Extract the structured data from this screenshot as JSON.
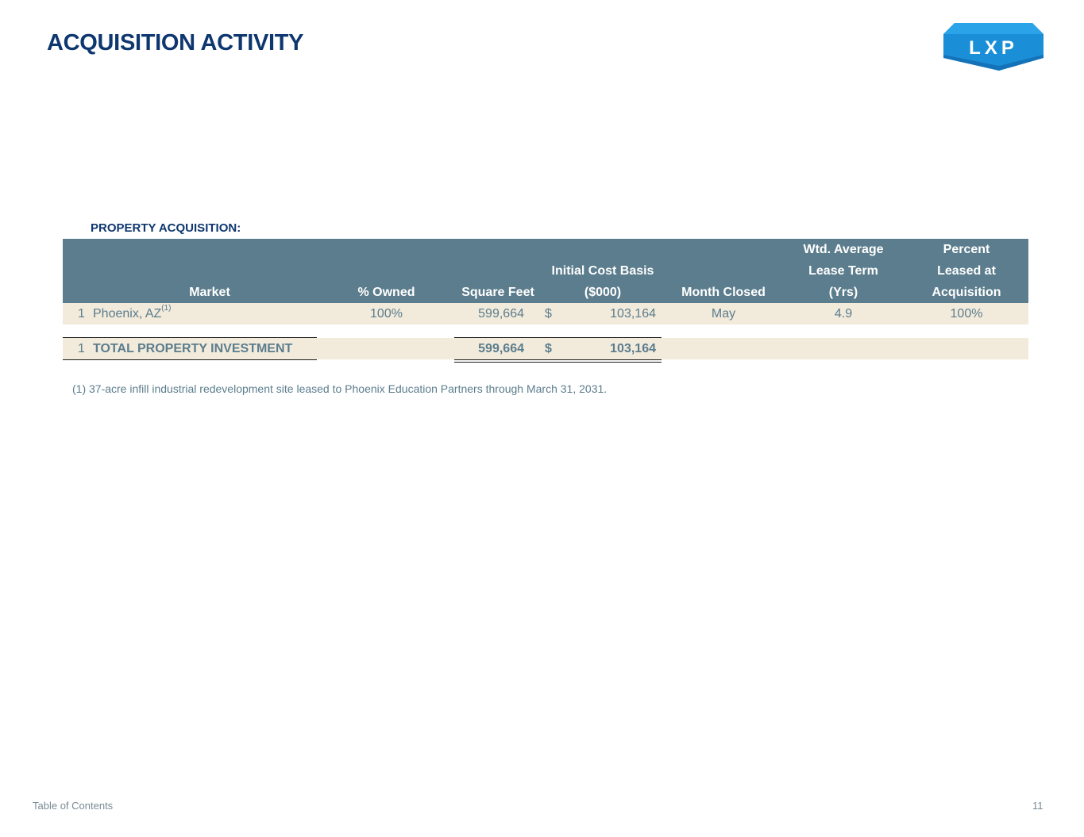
{
  "page": {
    "title": "ACQUISITION ACTIVITY",
    "logo_text": "LXP",
    "section_label": "PROPERTY ACQUISITION:",
    "footnote": "(1) 37-acre infill industrial redevelopment site leased to Phoenix Education Partners through March 31, 2031.",
    "footer_link": "Table of Contents",
    "page_number": "11"
  },
  "table": {
    "headers": {
      "market": [
        "",
        "",
        "Market"
      ],
      "owned": [
        "",
        "",
        "% Owned"
      ],
      "sqft": [
        "",
        "",
        "Square Feet"
      ],
      "cost": [
        "",
        "Initial Cost Basis",
        "($000)"
      ],
      "month": [
        "",
        "",
        "Month Closed"
      ],
      "lease": [
        "Wtd. Average",
        "Lease Term",
        "(Yrs)"
      ],
      "leased": [
        "Percent",
        "Leased at",
        "Acquisition"
      ]
    },
    "rows": [
      {
        "count": "1",
        "market": "Phoenix, AZ",
        "market_sup": "(1)",
        "owned": "100%",
        "sqft": "599,664",
        "currency": "$",
        "cost": "103,164",
        "month": "May",
        "lease_term": "4.9",
        "leased": "100%"
      }
    ],
    "total": {
      "count": "1",
      "label": "TOTAL PROPERTY INVESTMENT",
      "sqft": "599,664",
      "currency": "$",
      "cost": "103,164"
    }
  },
  "colors": {
    "title": "#0e3770",
    "header_bg": "#5b7d8d",
    "row_bg": "#f2eadb",
    "logo_blue": "#1a8fd8"
  }
}
